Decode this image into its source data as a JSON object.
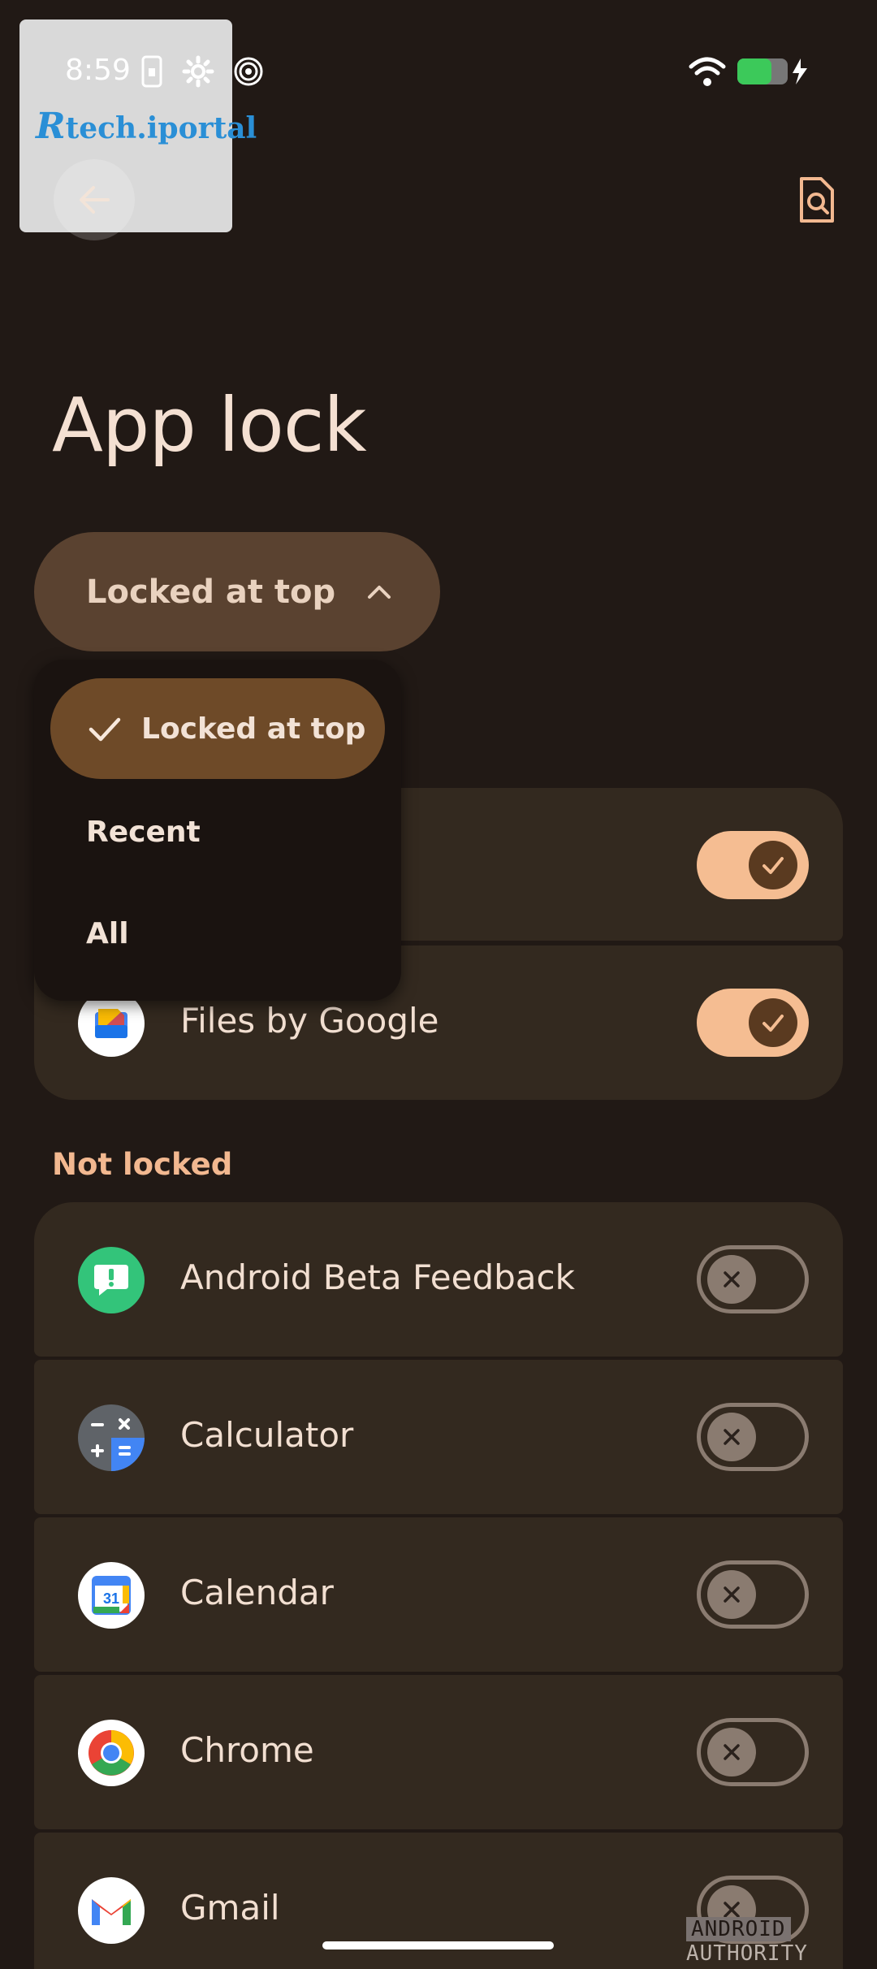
{
  "status_bar": {
    "time": "8:59"
  },
  "watermark": {
    "brand": "tech.iportal",
    "corner_mark_a": "ANDROID",
    "corner_mark_b": "AUTHORITY"
  },
  "header": {
    "title": "App lock",
    "back_icon": "arrow-left-icon",
    "search_icon": "document-search-icon"
  },
  "sort": {
    "selected_label": "Locked at top",
    "options": [
      {
        "label": "Locked at top",
        "selected": true
      },
      {
        "label": "Recent",
        "selected": false
      },
      {
        "label": "All",
        "selected": false
      }
    ]
  },
  "locked_apps": [
    {
      "name": "",
      "locked": true
    },
    {
      "name": "Files by Google",
      "locked": true
    }
  ],
  "sections": {
    "not_locked": "Not locked"
  },
  "unlocked_apps": [
    {
      "name": "Android Beta Feedback",
      "locked": false
    },
    {
      "name": "Calculator",
      "locked": false
    },
    {
      "name": "Calendar",
      "locked": false
    },
    {
      "name": "Chrome",
      "locked": false
    },
    {
      "name": "Gmail",
      "locked": false
    }
  ],
  "colors": {
    "background": "#211915",
    "card": "#33291f",
    "accent": "#f5bd92",
    "chip": "#5a4230"
  }
}
